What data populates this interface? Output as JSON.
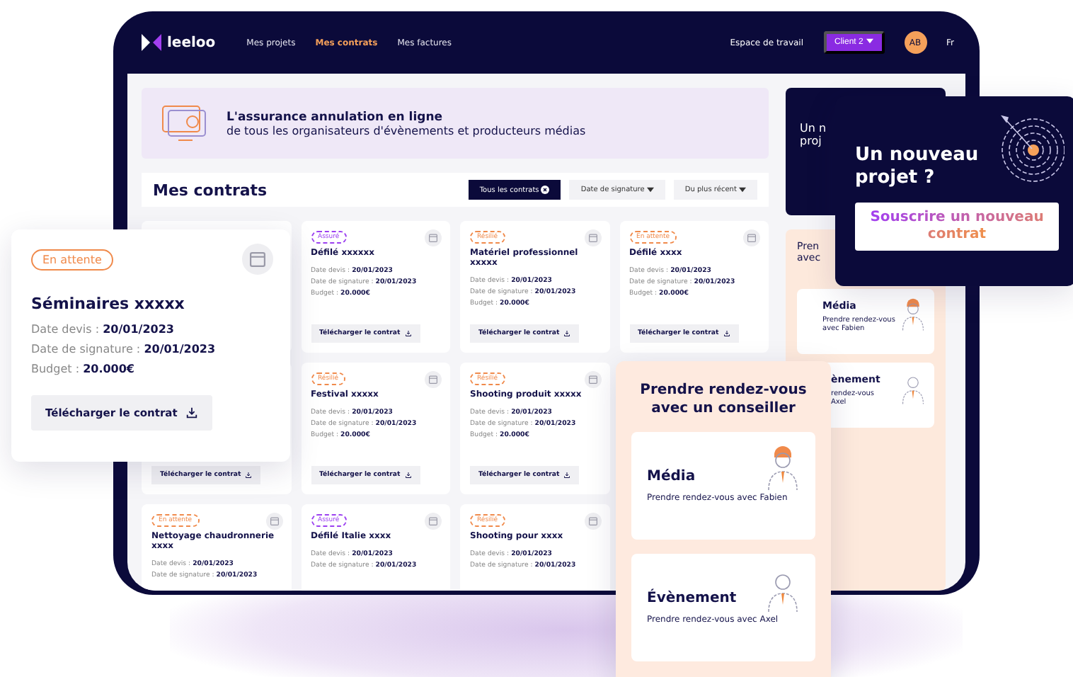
{
  "nav": {
    "logo": "leeloo",
    "links": [
      {
        "label": "Mes projets",
        "selected": false
      },
      {
        "label": "Mes contrats",
        "selected": true
      },
      {
        "label": "Mes factures",
        "selected": false
      }
    ],
    "workspace": "Espace de travail",
    "client": "Client 2",
    "avatar": "AB",
    "language": "Fr"
  },
  "banner": {
    "title": "L'assurance annulation en ligne",
    "subtitle": "de tous les organisateurs d'évènements et producteurs médias"
  },
  "contracts": {
    "title": "Mes contrats",
    "filters": [
      {
        "label": "Tous les contrats",
        "selected": true
      },
      {
        "label": "Date de signature",
        "selected": false
      },
      {
        "label": "Du plus récent",
        "selected": false
      }
    ],
    "cards": [
      {
        "status": "Assuré",
        "kind": "assured",
        "title": "Défilé xxxxxx",
        "lines": [
          {
            "label": "Date devis :",
            "value": "20/01/2023"
          },
          {
            "label": "Date de signature :",
            "value": "20/01/2023"
          },
          {
            "label": "Budget :",
            "value": "20.000€"
          }
        ],
        "button": "Télécharger le contrat"
      },
      {
        "status": "Résilié",
        "kind": "pending",
        "title": "Matériel professionnel xxxxx",
        "lines": [
          {
            "label": "Date devis :",
            "value": "20/01/2023"
          },
          {
            "label": "Date de signature :",
            "value": "20/01/2023"
          },
          {
            "label": "Budget :",
            "value": "20.000€"
          }
        ],
        "button": "Télécharger le contrat"
      },
      {
        "status": "En attente",
        "kind": "pending",
        "title": "Défilé xxxx",
        "lines": [
          {
            "label": "Date devis :",
            "value": "20/01/2023"
          },
          {
            "label": "Date de signature :",
            "value": "20/01/2023"
          },
          {
            "label": "Budget :",
            "value": "20.000€"
          }
        ],
        "button": "Télécharger le contrat"
      },
      {
        "button": "Télécharger le contrat"
      },
      {
        "status": "Résilié",
        "kind": "pending",
        "title": "Festival xxxxx",
        "lines": [
          {
            "label": "Date devis :",
            "value": "20/01/2023"
          },
          {
            "label": "Date de signature :",
            "value": "20/01/2023"
          },
          {
            "label": "Budget :",
            "value": "20.000€"
          }
        ],
        "button": "Télécharger le contrat"
      },
      {
        "status": "Résilié",
        "kind": "pending",
        "title": "Shooting produit xxxxx",
        "lines": [
          {
            "label": "Date devis :",
            "value": "20/01/2023"
          },
          {
            "label": "Date de signature :",
            "value": "20/01/2023"
          },
          {
            "label": "Budget :",
            "value": "20.000€"
          }
        ],
        "button": "Télécharger le contrat"
      },
      {
        "status": "En attente",
        "kind": "pending",
        "title": "Nettoyage chaudronnerie xxxx",
        "lines": [
          {
            "label": "Date devis :",
            "value": "20/01/2023"
          },
          {
            "label": "Date de signature :",
            "value": "20/01/2023"
          }
        ]
      },
      {
        "status": "Assuré",
        "kind": "assured",
        "title": "Défilé Italie xxxx",
        "lines": [
          {
            "label": "Date devis :",
            "value": "20/01/2023"
          },
          {
            "label": "Date de signature :",
            "value": "20/01/2023"
          }
        ]
      },
      {
        "status": "Résilié",
        "kind": "pending",
        "title": "Shooting pour xxxx",
        "lines": [
          {
            "label": "Date devis :",
            "value": "20/01/2023"
          },
          {
            "label": "Date de signature :",
            "value": "20/01/2023"
          }
        ]
      }
    ]
  },
  "sidebar": {
    "cta_lines": [
      "Un n",
      "proj"
    ],
    "panel_lines": [
      "Pren",
      "avec"
    ],
    "advisors": [
      {
        "title": "Média",
        "lines": [
          "Prendre rendez-vous",
          "avec Fabien"
        ]
      },
      {
        "title": "ènement",
        "lines": [
          "rendez-vous",
          "Axel"
        ]
      }
    ]
  },
  "featured_contract": {
    "status": "En attente",
    "kind": "pending",
    "title": "Séminaires xxxxx",
    "lines": [
      {
        "label": "Date devis :",
        "value": "20/01/2023"
      },
      {
        "label": "Date de signature :",
        "value": "20/01/2023"
      },
      {
        "label": "Budget :",
        "value": "20.000€"
      }
    ],
    "button": "Télécharger le contrat"
  },
  "new_project": {
    "title": "Un nouveau projet ?",
    "button": "Souscrire un nouveau contrat"
  },
  "appointment": {
    "title": "Prendre rendez-vous avec un conseiller",
    "advisors": [
      {
        "title": "Média",
        "text": "Prendre rendez-vous avec Fabien"
      },
      {
        "title": "Évènement",
        "text": "Prendre rendez-vous avec Axel"
      }
    ]
  }
}
